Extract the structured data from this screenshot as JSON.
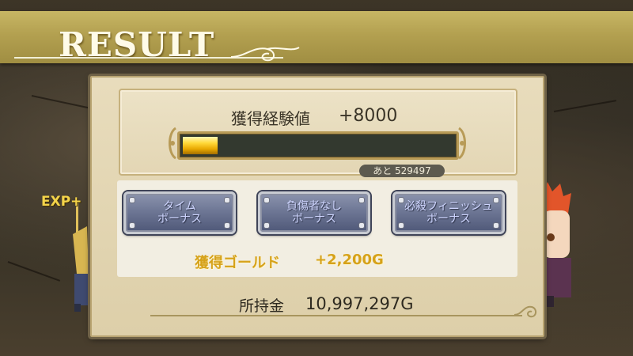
{
  "banner": {
    "title": "RESULT"
  },
  "exp": {
    "label": "獲得経験値",
    "value": "+8000",
    "remaining_text": "あと 529497",
    "fill_fraction": 0.13
  },
  "bonuses": [
    {
      "label": "タイム\nボーナス"
    },
    {
      "label": "負傷者なし\nボーナス"
    },
    {
      "label": "必殺フィニッシュ\nボーナス"
    }
  ],
  "gold": {
    "label": "獲得ゴールド",
    "value": "+2,200G"
  },
  "money": {
    "label": "所持金",
    "value": "10,997,297G"
  },
  "floating_text": "EXP+",
  "colors": {
    "banner": "#b3a050",
    "gold_text": "#d6a21a",
    "bar_fill": "#ffd93a",
    "button": "#6e7795"
  }
}
